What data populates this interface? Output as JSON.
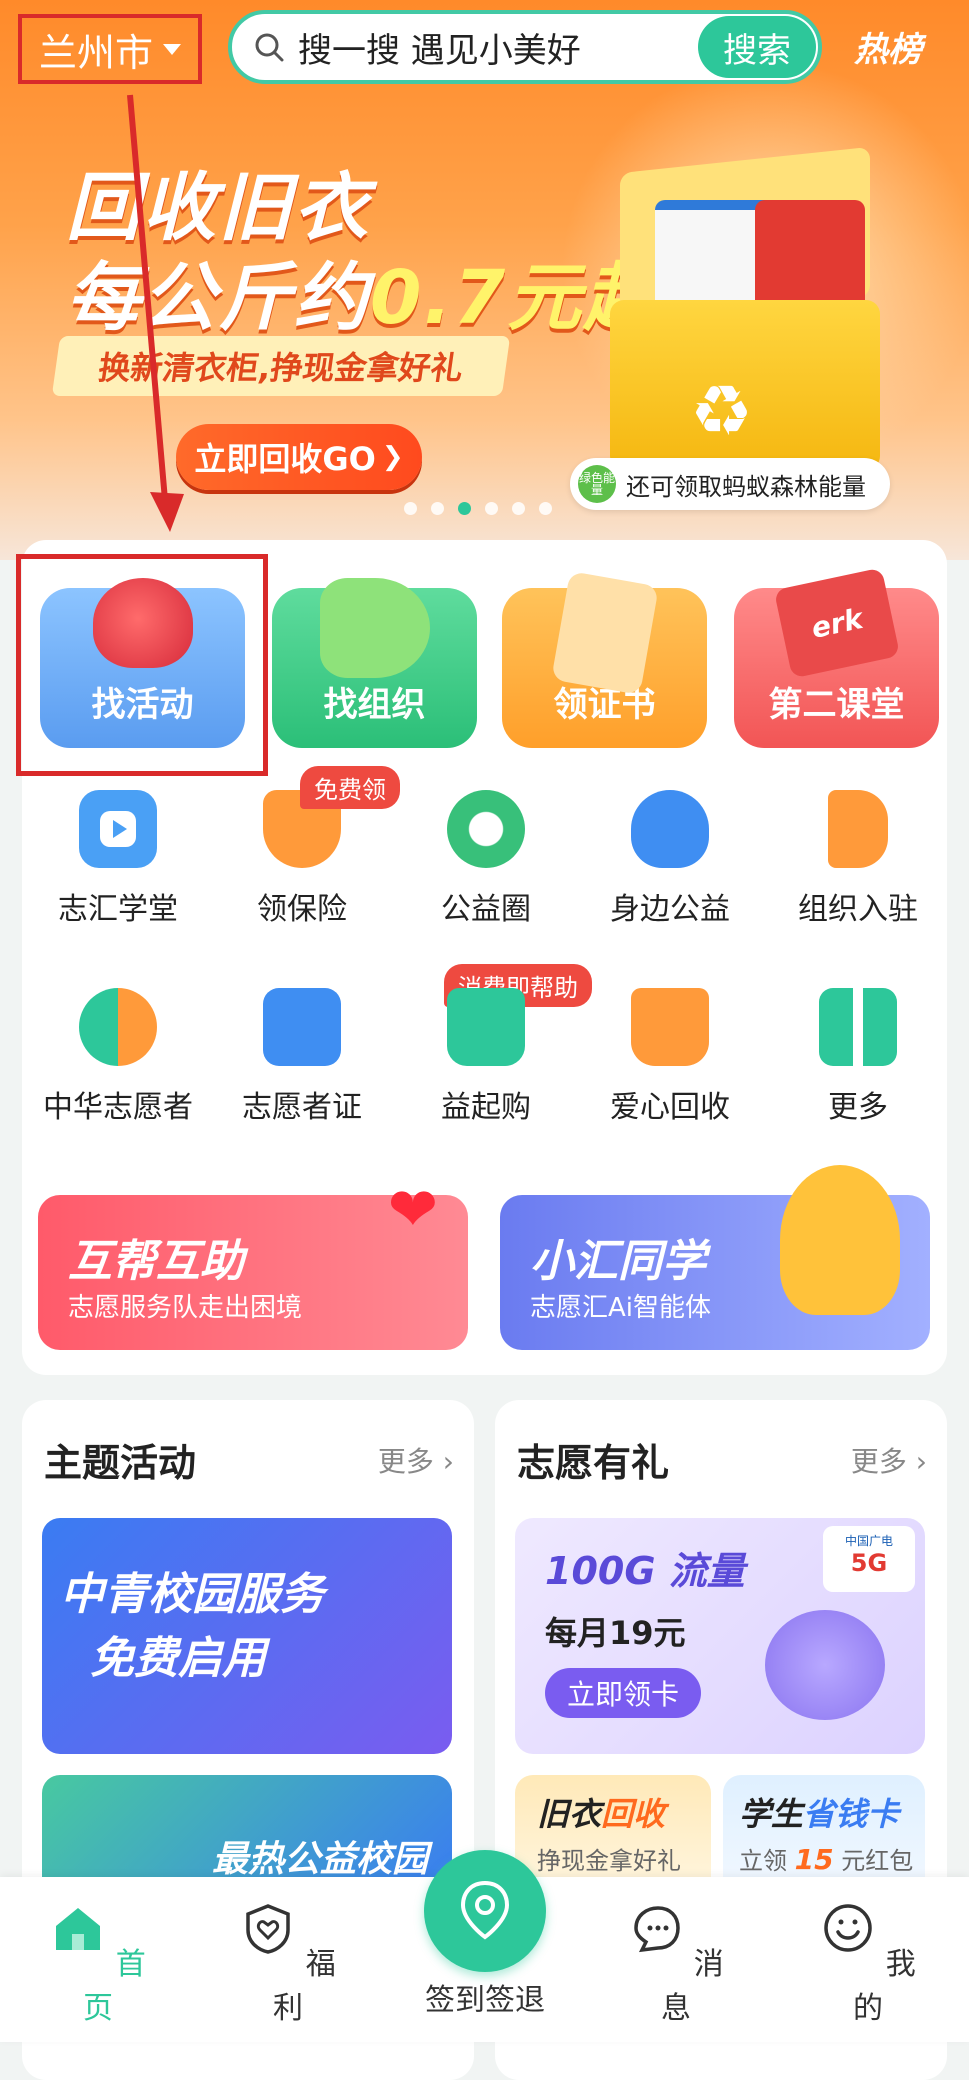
{
  "header": {
    "city": "兰州市",
    "search_placeholder": "搜一搜 遇见小美好",
    "search_button": "搜索",
    "hot_label": "热榜"
  },
  "banner": {
    "title_line1": "回收旧衣",
    "title_line2_prefix": "每公斤约",
    "title_line2_highlight": "0.7元起",
    "subtitle": "换新清衣柜,挣现金拿好礼",
    "cta_label": "立即回收GO",
    "cta_arrow": "❯",
    "ant_badge": "绿色能量",
    "ant_text": "还可领取蚂蚁森林能量",
    "slide_count": 6,
    "active_slide": 3
  },
  "quick_entries": [
    {
      "label": "找活动",
      "color": "#5aa8f0"
    },
    {
      "label": "找组织",
      "color": "#39c98a"
    },
    {
      "label": "领证书",
      "color": "#ffae3a"
    },
    {
      "label": "第二课堂",
      "color": "#ff6a6a"
    }
  ],
  "services_row1": [
    {
      "label": "志汇学堂",
      "icon": "play-icon"
    },
    {
      "label": "领保险",
      "icon": "shield-heart-icon",
      "tag": "免费领"
    },
    {
      "label": "公益圈",
      "icon": "leaf-ring-icon"
    },
    {
      "label": "身边公益",
      "icon": "heart-location-icon"
    },
    {
      "label": "组织入驻",
      "icon": "flag-icon"
    }
  ],
  "services_row2": [
    {
      "label": "中华志愿者",
      "icon": "volunteer-logo-icon"
    },
    {
      "label": "志愿者证",
      "icon": "id-card-icon"
    },
    {
      "label": "益起购",
      "icon": "shopping-bag-icon",
      "tag": "消费即帮助"
    },
    {
      "label": "爱心回收",
      "icon": "love-box-icon"
    },
    {
      "label": "更多",
      "icon": "grid-icon"
    }
  ],
  "promos": [
    {
      "title": "互帮互助",
      "subtitle": "志愿服务队走出困境"
    },
    {
      "title": "小汇同学",
      "subtitle": "志愿汇Ai智能体"
    }
  ],
  "theme_card": {
    "title": "主题活动",
    "more": "更多 ›",
    "banner1": "中青校园服务",
    "banner1_line2": "免费启用",
    "banner2": "最热公益校园"
  },
  "gift_card": {
    "title": "志愿有礼",
    "more": "更多 ›",
    "flow_title": "100G 流量",
    "flow_price": "每月19元",
    "flow_cta": "立即领卡",
    "carrier": "中国广电",
    "carrier_tag": "5G",
    "mini1_title_a": "旧衣",
    "mini1_title_b": "回收",
    "mini1_sub": "挣现金拿好礼",
    "mini2_title_a": "学生",
    "mini2_title_b": "省钱卡",
    "mini2_sub_a": "立领",
    "mini2_sub_num": "15",
    "mini2_sub_b": "元红包"
  },
  "bottom_nav": [
    {
      "label": "首页",
      "active": true
    },
    {
      "label": "福利",
      "active": false
    },
    {
      "label": "签到签退",
      "active": false
    },
    {
      "label": "消息",
      "active": false
    },
    {
      "label": "我的",
      "active": false
    }
  ],
  "colors": {
    "accent": "#2dc79a",
    "annotation_red": "#d92a2a"
  }
}
